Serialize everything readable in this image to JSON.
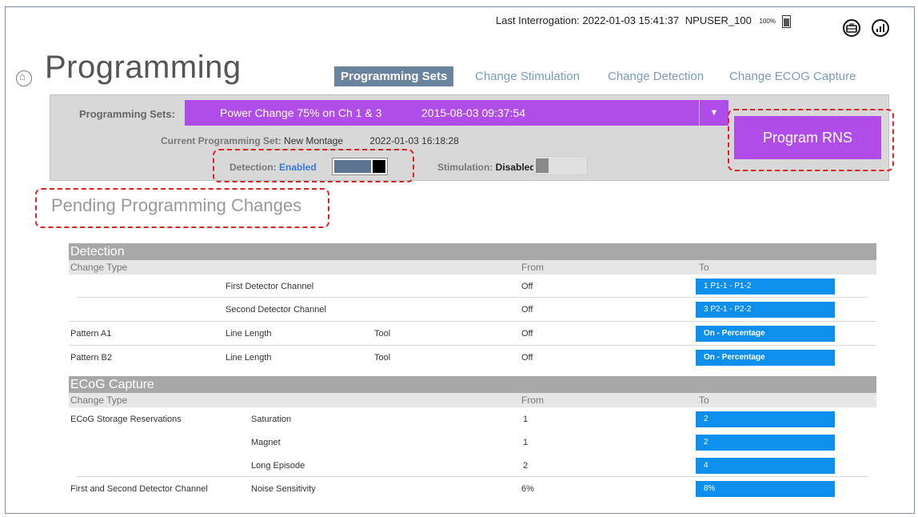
{
  "header": {
    "last_interrogation_label": "Last Interrogation:",
    "last_interrogation": "2022-01-03 15:41:37",
    "user": "NPUSER_100",
    "battery_pct": "100%",
    "icons": [
      "home-icon",
      "briefcase-icon",
      "signal-icon",
      "battery-icon"
    ]
  },
  "page": {
    "title": "Programming"
  },
  "tabs": [
    "Programming Sets",
    "Change Stimulation",
    "Change Detection",
    "Change ECOG Capture"
  ],
  "programming_sets": {
    "label": "Programming Sets:",
    "selected_name": "Power Change 75% on Ch 1 & 3",
    "selected_date": "2015-08-03 09:37:54",
    "current_label": "Current Programming Set:",
    "current_name": "New Montage",
    "current_date": "2022-01-03 16:18:28",
    "detection_label": "Detection:",
    "detection_value": "Enabled",
    "stimulation_label": "Stimulation:",
    "stimulation_value": "Disabled",
    "program_button": "Program RNS"
  },
  "pending": {
    "title": "Pending Programming Changes",
    "detection": {
      "title": "Detection",
      "col_change_type": "Change Type",
      "col_from": "From",
      "col_to": "To",
      "rows": [
        {
          "a": "",
          "b": "First Detector Channel",
          "c": "",
          "from": "Off",
          "to": "1   P1-1 - P1-2"
        },
        {
          "a": "",
          "b": "Second Detector Channel",
          "c": "",
          "from": "Off",
          "to": "3   P2-1 - P2-2"
        },
        {
          "a": "Pattern A1",
          "b": "Line Length",
          "c": "Tool",
          "from": "Off",
          "to": "On - Percentage"
        },
        {
          "a": "Pattern B2",
          "b": "Line Length",
          "c": "Tool",
          "from": "Off",
          "to": "On - Percentage"
        }
      ]
    },
    "ecog": {
      "title": "ECoG Capture",
      "col_change_type": "Change Type",
      "col_from": "From",
      "col_to": "To",
      "rows": [
        {
          "a": "ECoG Storage Reservations",
          "b": "Saturation",
          "from": "1",
          "to": "2"
        },
        {
          "a": "",
          "b": "Magnet",
          "from": "1",
          "to": "2"
        },
        {
          "a": "",
          "b": "Long Episode",
          "from": "2",
          "to": "4"
        },
        {
          "a": "First and Second Detector Channel",
          "b": "Noise Sensitivity",
          "from": "6%",
          "to": "8%"
        }
      ]
    }
  },
  "colors": {
    "accent_purple": "#b04de8",
    "tab_active": "#6a84a0",
    "to_cell_blue": "#0d8fee",
    "highlight_red": "#e02020"
  }
}
